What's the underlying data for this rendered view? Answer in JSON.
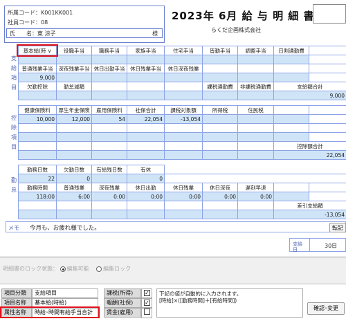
{
  "header": {
    "office_code": "所属コード：K001KK001",
    "employee_code": "社員コード：08",
    "name_label": "氏　　名：東 涼子",
    "honorific": "様",
    "title": "2023年 6月 給 与 明 細 書",
    "company": "らくだ企画株式会社"
  },
  "payment": {
    "side_label": [
      "支",
      "給",
      "項",
      "目"
    ],
    "row1_headers": [
      "基本給(時",
      "役職手当",
      "職務手当",
      "家族手当",
      "住宅手当",
      "皆勤手当",
      "調整手当",
      "日割通勤費"
    ],
    "row2_headers": [
      "普通残業手当",
      "深夜残業手当",
      "休日出勤手当",
      "休日残業手当",
      "休日深夜残業",
      "",
      "",
      ""
    ],
    "row2_values": [
      "9,000",
      "",
      "",
      "",
      "",
      "",
      "",
      ""
    ],
    "row3_headers": [
      "欠勤控除",
      "勤怠減額",
      "",
      "",
      "",
      "課税通勤費",
      "非課税通勤費",
      "支給額合計"
    ],
    "row3_values": [
      "",
      "",
      "",
      "",
      "",
      "",
      "",
      "9,000"
    ]
  },
  "deduction": {
    "side_label": [
      "控",
      "除",
      "項",
      "目"
    ],
    "row1_headers": [
      "健康保険料",
      "厚生年金保険",
      "雇用保険料",
      "社保合計",
      "課税対象額",
      "所得税",
      "住民税",
      ""
    ],
    "row1_values": [
      "10,000",
      "12,000",
      "54",
      "22,054",
      "-13,054",
      "",
      "",
      ""
    ],
    "total_label": "控除額合計",
    "total_value": "22,054"
  },
  "attendance": {
    "side_label": [
      "勤",
      "怠"
    ],
    "row1_headers": [
      "勤務日数",
      "欠勤日数",
      "有給残日数",
      "有休"
    ],
    "row1_values": [
      "22",
      "0",
      "",
      "0"
    ],
    "row2_headers": [
      "勤務時間",
      "普通残業",
      "深夜残業",
      "休日出勤",
      "休日残業",
      "休日深夜",
      "遅刻早退"
    ],
    "row2_values": [
      "118:00",
      "6:00",
      "0:00",
      "0:00",
      "0:00",
      "0:00",
      "0:00"
    ],
    "net_label": "差引支給額",
    "net_value": "-13,054"
  },
  "memo": {
    "label": "メモ",
    "text": "今月も、お疲れ様でした。",
    "button": "転記"
  },
  "payday": {
    "label": "支給日",
    "value": "30日"
  },
  "lock": {
    "label": "明細書のロック状態：",
    "option_editable": "編集可能",
    "option_locked": "編集ロック"
  },
  "properties": {
    "category_label": "項目分類",
    "category_value": "支給項目",
    "item_name_label": "項目名称",
    "item_name_value": "基本給(時給)",
    "attr_label": "属性名称",
    "attr_value": "時給･時間有給手当合計",
    "tax_label": "課税(所得)",
    "social_label": "報酬(社保)",
    "wage_label": "賃金(雇用)",
    "desc_line1": "下記の値が自動的に入力されます。",
    "desc_line2": "[時給]×([勤務時間]＋[有給時間])",
    "confirm_button": "確認･変更"
  },
  "colors": {
    "grid_border": "#8da3e6",
    "cell_fill": "#cfe4f7",
    "highlight": "#e0101a"
  }
}
